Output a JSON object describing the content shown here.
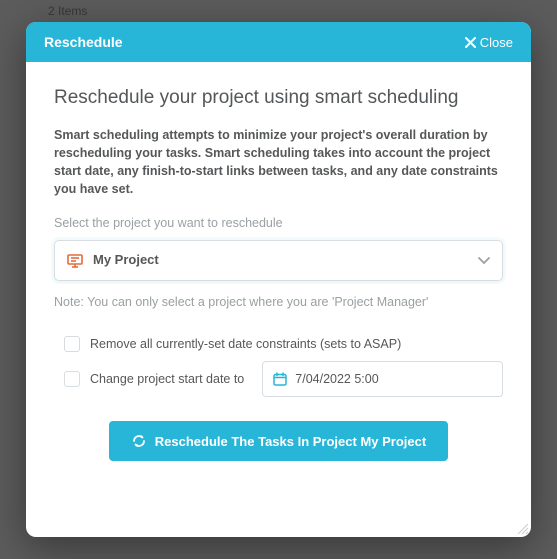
{
  "background": {
    "items_text": "2 Items"
  },
  "modal": {
    "header_title": "Reschedule",
    "close_label": "Close",
    "title": "Reschedule your project using smart scheduling",
    "description": "Smart scheduling attempts to minimize your project's overall duration by rescheduling your tasks. Smart scheduling takes into account the project start date, any finish-to-start links between tasks, and any date constraints you have set.",
    "select_label": "Select the project you want to reschedule",
    "project": {
      "name": "My Project"
    },
    "note": "Note: You can only select a project where you are 'Project Manager'",
    "options": {
      "remove_constraints_label": "Remove all currently-set date constraints (sets to ASAP)",
      "change_start_label": "Change project start date to",
      "start_date_value": "7/04/2022 5:00"
    },
    "submit_label": "Reschedule The Tasks In Project My Project"
  }
}
